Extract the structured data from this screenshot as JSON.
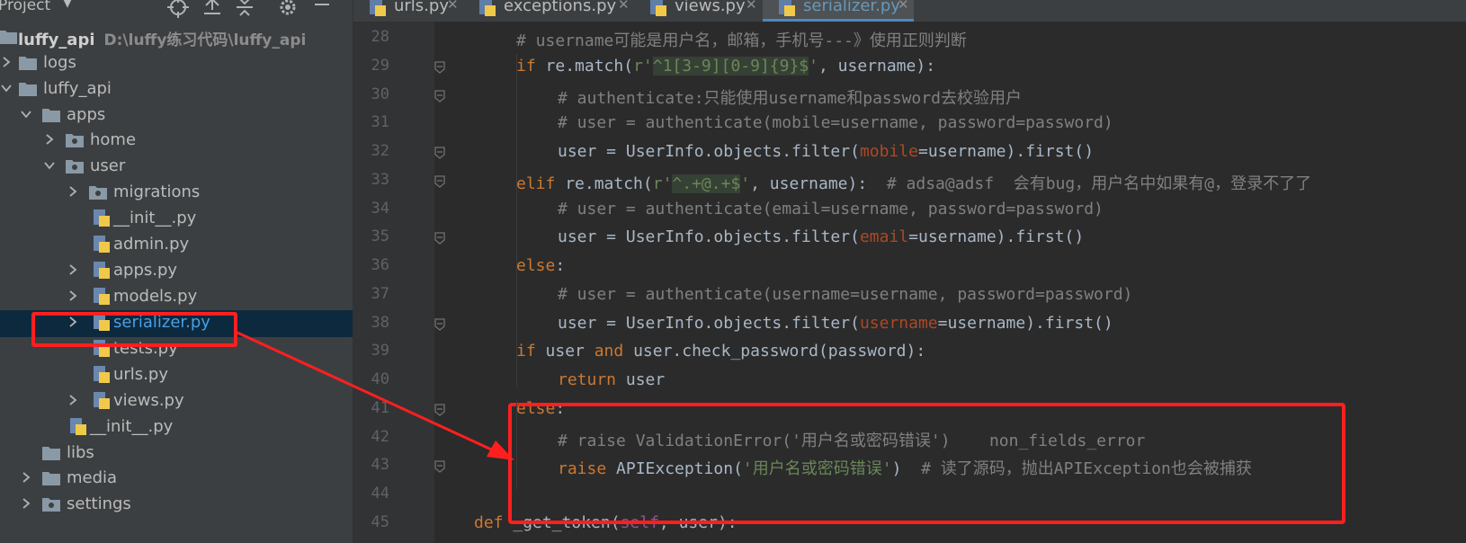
{
  "project_panel": {
    "title": "Project",
    "tree": [
      {
        "label": "luffy_api",
        "path": "D:\\luffy练习代码\\luffy_api",
        "type": "folder",
        "bold": true
      },
      {
        "label": "logs",
        "type": "folder"
      },
      {
        "label": "luffy_api",
        "type": "folder"
      },
      {
        "label": "apps",
        "type": "folder"
      },
      {
        "label": "home",
        "type": "package"
      },
      {
        "label": "user",
        "type": "package"
      },
      {
        "label": "migrations",
        "type": "package"
      },
      {
        "label": "__init__.py",
        "type": "py"
      },
      {
        "label": "admin.py",
        "type": "py"
      },
      {
        "label": "apps.py",
        "type": "py"
      },
      {
        "label": "models.py",
        "type": "py"
      },
      {
        "label": "serializer.py",
        "type": "py",
        "selected": true
      },
      {
        "label": "tests.py",
        "type": "py"
      },
      {
        "label": "urls.py",
        "type": "py"
      },
      {
        "label": "views.py",
        "type": "py"
      },
      {
        "label": "__init__.py",
        "type": "py"
      },
      {
        "label": "libs",
        "type": "folder"
      },
      {
        "label": "media",
        "type": "folder"
      },
      {
        "label": "settings",
        "type": "package"
      }
    ]
  },
  "tabs": [
    {
      "label": "urls.py"
    },
    {
      "label": "exceptions.py"
    },
    {
      "label": "views.py"
    },
    {
      "label": "serializer.py",
      "active": true
    }
  ],
  "editor": {
    "lines": [
      {
        "n": "28",
        "text": "# username可能是用户名，邮箱，手机号---》使用正则判断"
      },
      {
        "n": "29",
        "text": "if re.match(r'^1[3-9][0-9]{9}$', username):"
      },
      {
        "n": "30",
        "text": "# authenticate:只能使用username和password去校验用户"
      },
      {
        "n": "31",
        "text": "# user = authenticate(mobile=username, password=password)"
      },
      {
        "n": "32",
        "text": "user = UserInfo.objects.filter(mobile=username).first()"
      },
      {
        "n": "33",
        "text": "elif re.match(r'^.+@.+$', username):  # adsa@adsf  会有bug，用户名中如果有@，登录不了了"
      },
      {
        "n": "34",
        "text": "# user = authenticate(email=username, password=password)"
      },
      {
        "n": "35",
        "text": "user = UserInfo.objects.filter(email=username).first()"
      },
      {
        "n": "36",
        "text": "else:"
      },
      {
        "n": "37",
        "text": "# user = authenticate(username=username, password=password)"
      },
      {
        "n": "38",
        "text": "user = UserInfo.objects.filter(username=username).first()"
      },
      {
        "n": "39",
        "text": "if user and user.check_password(password):"
      },
      {
        "n": "40",
        "text": "return user"
      },
      {
        "n": "41",
        "text": "else:"
      },
      {
        "n": "42",
        "text": "# raise ValidationError('用户名或密码错误')    non_fields_error"
      },
      {
        "n": "43",
        "text": "raise APIException('用户名或密码错误')  # 读了源码，抛出APIException也会被捕获"
      },
      {
        "n": "44",
        "text": ""
      },
      {
        "n": "45",
        "text": "def _get_token(self, user):"
      }
    ]
  },
  "colors": {
    "annotation": "#ff1f1f",
    "keyword": "#cc7832",
    "comment": "#808080",
    "string": "#6a8759",
    "selection": "#0d293e"
  }
}
